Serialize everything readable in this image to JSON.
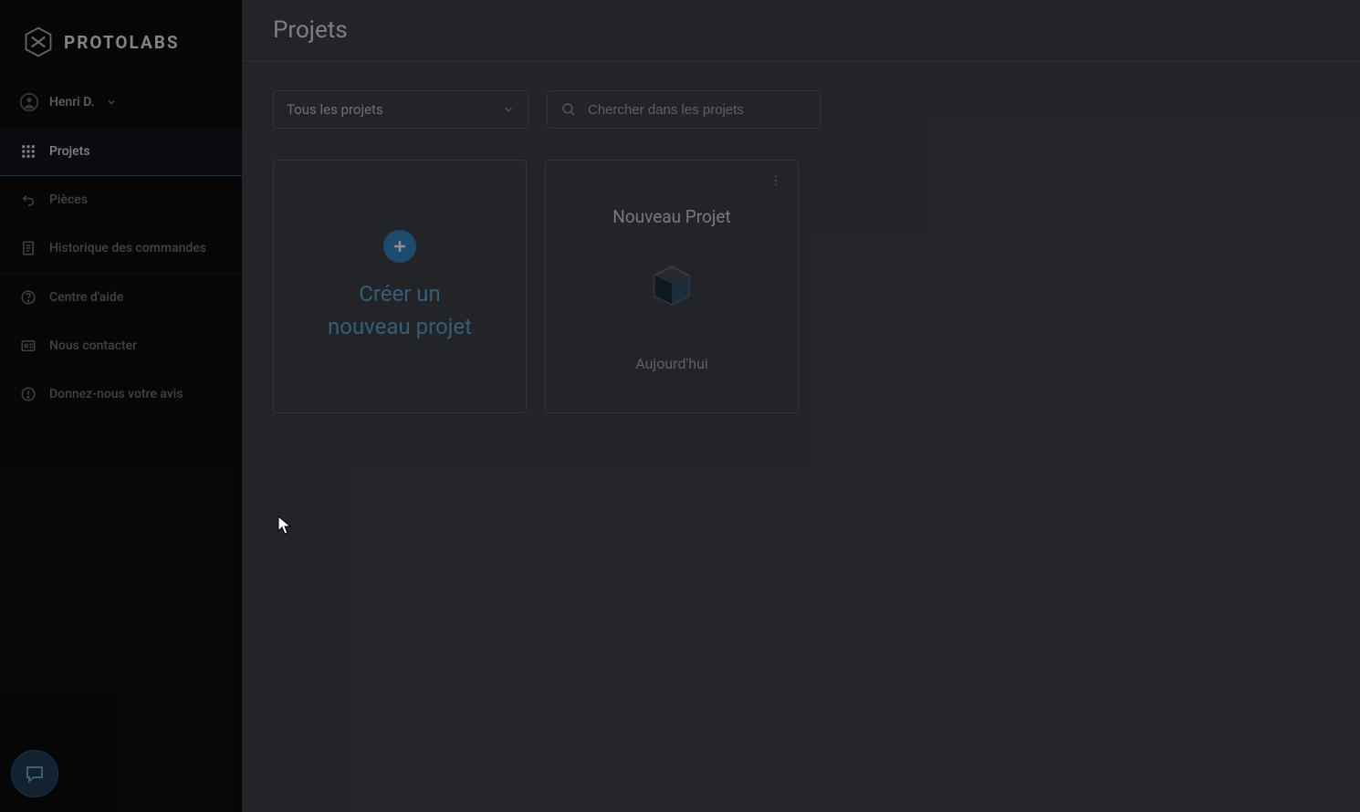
{
  "brand": {
    "name": "PROTOLABS"
  },
  "user": {
    "display_name": "Henri D."
  },
  "sidebar": {
    "items": [
      {
        "label": "Projets",
        "icon": "grid-icon",
        "active": true
      },
      {
        "label": "Pièces",
        "icon": "undo-icon",
        "active": false
      },
      {
        "label": "Historique des commandes",
        "icon": "receipt-icon",
        "active": false
      },
      {
        "label": "Centre d'aide",
        "icon": "help-icon",
        "active": false
      },
      {
        "label": "Nous contacter",
        "icon": "contact-icon",
        "active": false
      },
      {
        "label": "Donnez-nous votre avis",
        "icon": "feedback-icon",
        "active": false
      }
    ]
  },
  "page": {
    "title": "Projets"
  },
  "toolbar": {
    "filter_value": "Tous les projets",
    "search_placeholder": "Chercher dans les projets"
  },
  "cards": {
    "create_label": "Créer un nouveau projet",
    "projects": [
      {
        "title": "Nouveau Projet",
        "date": "Aujourd'hui"
      }
    ]
  }
}
